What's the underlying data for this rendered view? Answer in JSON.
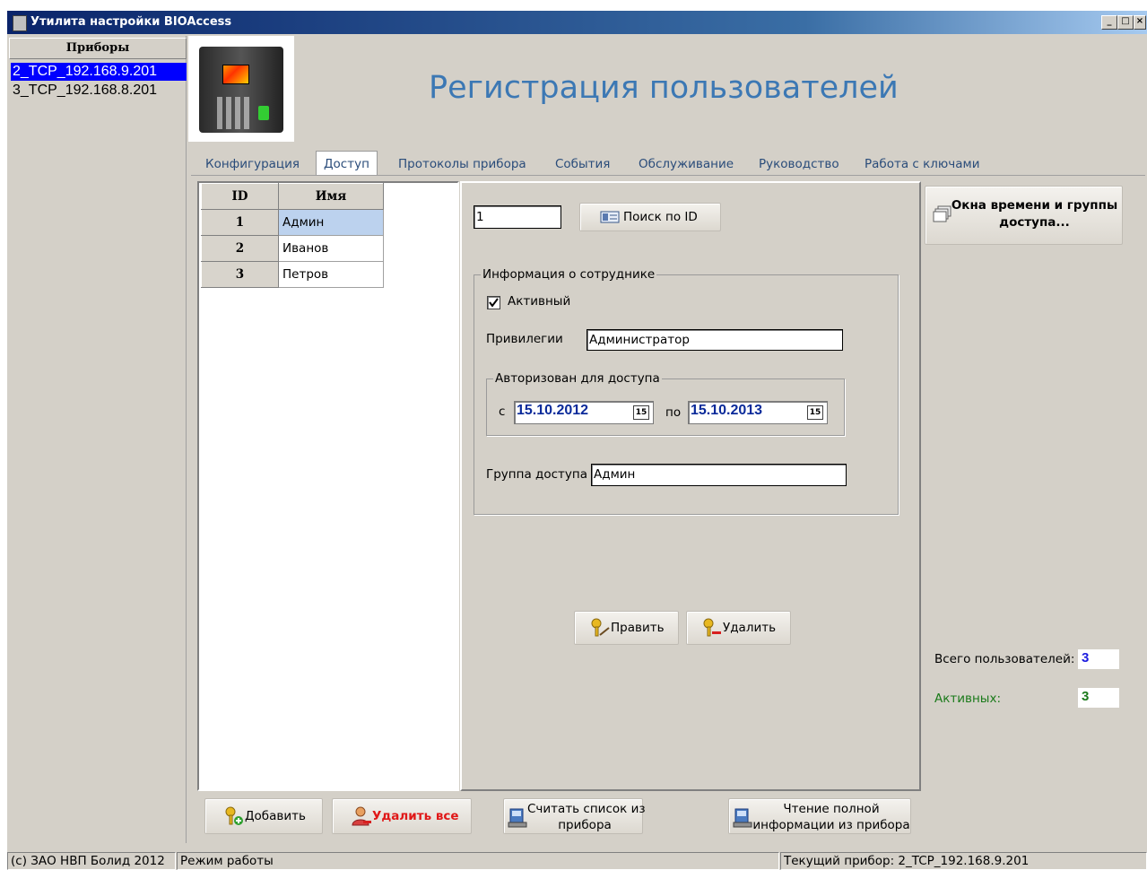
{
  "window": {
    "title": "Утилита настройки BIOAccess",
    "buttons": {
      "minimize": "_",
      "maximize": "□",
      "close": "×"
    }
  },
  "devices": {
    "header": "Приборы",
    "items": [
      {
        "label": "2_TCP_192.168.9.201",
        "selected": true
      },
      {
        "label": "3_TCP_192.168.8.201",
        "selected": false
      }
    ]
  },
  "page_title": "Регистрация пользователей",
  "tabs": [
    {
      "label": "Конфигурация",
      "active": false
    },
    {
      "label": "Доступ",
      "active": true
    },
    {
      "label": "Протоколы прибора",
      "active": false
    },
    {
      "label": "События",
      "active": false
    },
    {
      "label": "Обслуживание",
      "active": false
    },
    {
      "label": "Руководство",
      "active": false
    },
    {
      "label": "Работа с ключами",
      "active": false
    }
  ],
  "users_table": {
    "columns": [
      "ID",
      "Имя"
    ],
    "rows": [
      {
        "id": "1",
        "name": "Админ",
        "selected": true
      },
      {
        "id": "2",
        "name": "Иванов",
        "selected": false
      },
      {
        "id": "3",
        "name": "Петров",
        "selected": false
      }
    ]
  },
  "search": {
    "value": "1",
    "button": "Поиск по ID"
  },
  "employee": {
    "group_title": "Информация о сотруднике",
    "active_label": "Активный",
    "active_checked": true,
    "privileges_label": "Привилегии",
    "privileges_value": "Администратор",
    "auth_group_title": "Авторизован для доступа",
    "from_label": "с",
    "from_date": "15.10.2012",
    "to_label": "по",
    "to_date": "15.10.2013",
    "calendar_glyph": "15",
    "access_group_label": "Группа доступа",
    "access_group_value": "Админ"
  },
  "actions": {
    "edit": "Править",
    "delete": "Удалить"
  },
  "time_windows_button": {
    "line1": "Окна времени и группы",
    "line2": "доступа..."
  },
  "stats": {
    "total_label": "Всего пользователей:",
    "total_value": "3",
    "active_label": "Активных:",
    "active_value": "3"
  },
  "bottom_buttons": {
    "add": "Добавить",
    "delete_all": "Удалить все",
    "read_list_1": "Считать список из",
    "read_list_2": "прибора",
    "read_full_1": "Чтение полной",
    "read_full_2": "информации из прибора"
  },
  "status": {
    "copyright": "(c) ЗАО НВП Болид 2012",
    "mode": "Режим работы",
    "current_device": "Текущий прибор: 2_TCP_192.168.9.201"
  },
  "colors": {
    "title_text": "#3c78b4",
    "selection": "#0000ff",
    "date_text": "#0a2a9a",
    "total_value": "#1c1ce0",
    "active_value": "#1a7a1a",
    "delete_all": "#e01818"
  }
}
